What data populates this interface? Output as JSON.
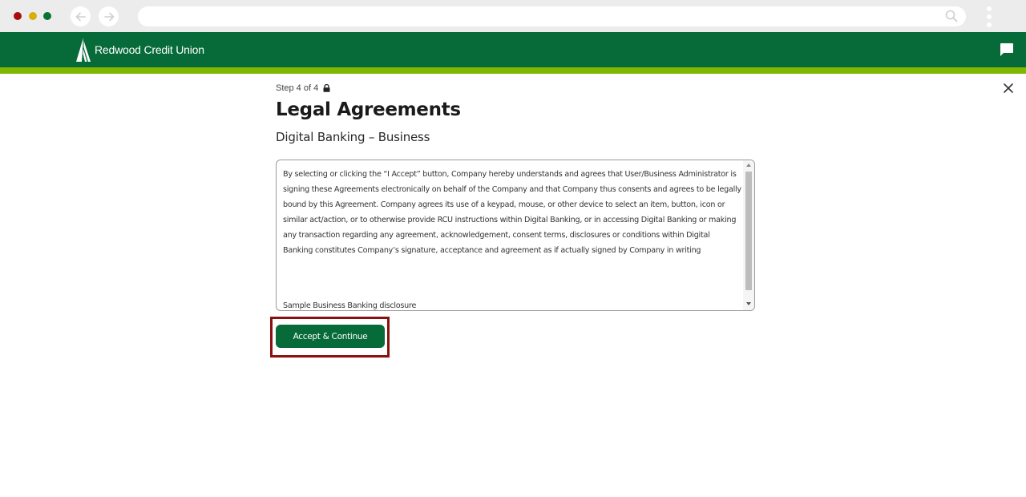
{
  "browser": {
    "address_value": ""
  },
  "header": {
    "brand_name": "Redwood Credit Union",
    "colors": {
      "primary": "#066a39",
      "accent_stripe": "#7fb800"
    }
  },
  "page": {
    "step_label": "Step 4 of 4",
    "title": "Legal Agreements",
    "subtitle": "Digital Banking – Business",
    "agreement_text": "By selecting or clicking the “I Accept” button, Company hereby understands and agrees that User/Business Administrator is signing these Agreements electronically on behalf of the Company and that Company thus consents and agrees to be legally bound by this Agreement. Company agrees its use of a keypad, mouse, or other device to select an item, button, icon or similar act/action, or to otherwise provide RCU instructions within Digital Banking, or in accessing Digital Banking or making any transaction regarding any agreement, acknowledgement, consent terms, disclosures or conditions within Digital Banking constitutes Company’s signature, acceptance and agreement as if actually signed by Company in writing",
    "agreement_text_next": "Sample Business Banking disclosure",
    "accept_button_label": "Accept & Continue"
  }
}
